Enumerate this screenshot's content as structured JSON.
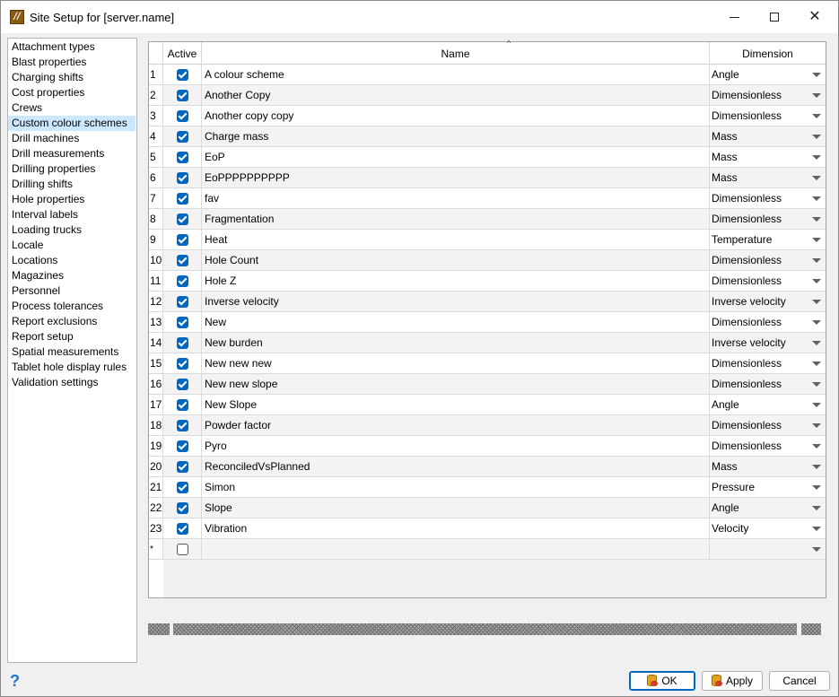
{
  "window": {
    "title": "Site Setup for [server.name]",
    "app_icon": "app-logo-icon",
    "controls": [
      "minimize-icon",
      "maximize-icon",
      "close-icon"
    ]
  },
  "sidebar": {
    "selected": "Custom colour schemes",
    "items": [
      "Attachment types",
      "Blast properties",
      "Charging shifts",
      "Cost properties",
      "Crews",
      "Custom colour schemes",
      "Drill machines",
      "Drill measurements",
      "Drilling properties",
      "Drilling shifts",
      "Hole properties",
      "Interval labels",
      "Loading trucks",
      "Locale",
      "Locations",
      "Magazines",
      "Personnel",
      "Process tolerances",
      "Report exclusions",
      "Report setup",
      "Spatial measurements",
      "Tablet hole display rules",
      "Validation settings"
    ]
  },
  "grid": {
    "columns": {
      "active": "Active",
      "name": "Name",
      "dimension": "Dimension"
    },
    "sorted_column": "Name",
    "rows": [
      {
        "num": "1",
        "active": true,
        "name": "A colour scheme",
        "dimension": "Angle"
      },
      {
        "num": "2",
        "active": true,
        "name": "Another Copy",
        "dimension": "Dimensionless"
      },
      {
        "num": "3",
        "active": true,
        "name": "Another copy copy",
        "dimension": "Dimensionless"
      },
      {
        "num": "4",
        "active": true,
        "name": "Charge mass",
        "dimension": "Mass"
      },
      {
        "num": "5",
        "active": true,
        "name": "EoP",
        "dimension": "Mass"
      },
      {
        "num": "6",
        "active": true,
        "name": "EoPPPPPPPPPP",
        "dimension": "Mass"
      },
      {
        "num": "7",
        "active": true,
        "name": "fav",
        "dimension": "Dimensionless"
      },
      {
        "num": "8",
        "active": true,
        "name": "Fragmentation",
        "dimension": "Dimensionless"
      },
      {
        "num": "9",
        "active": true,
        "name": "Heat",
        "dimension": "Temperature"
      },
      {
        "num": "10",
        "active": true,
        "name": "Hole Count",
        "dimension": "Dimensionless"
      },
      {
        "num": "11",
        "active": true,
        "name": "Hole Z",
        "dimension": "Dimensionless"
      },
      {
        "num": "12",
        "active": true,
        "name": "Inverse velocity",
        "dimension": "Inverse velocity"
      },
      {
        "num": "13",
        "active": true,
        "name": "New",
        "dimension": "Dimensionless"
      },
      {
        "num": "14",
        "active": true,
        "name": "New burden",
        "dimension": "Inverse velocity"
      },
      {
        "num": "15",
        "active": true,
        "name": "New new new",
        "dimension": "Dimensionless"
      },
      {
        "num": "16",
        "active": true,
        "name": "New new slope",
        "dimension": "Dimensionless"
      },
      {
        "num": "17",
        "active": true,
        "name": "New Slope",
        "dimension": "Angle"
      },
      {
        "num": "18",
        "active": true,
        "name": "Powder factor",
        "dimension": "Dimensionless"
      },
      {
        "num": "19",
        "active": true,
        "name": "Pyro",
        "dimension": "Dimensionless"
      },
      {
        "num": "20",
        "active": true,
        "name": "ReconciledVsPlanned",
        "dimension": "Mass"
      },
      {
        "num": "21",
        "active": true,
        "name": "Simon",
        "dimension": "Pressure"
      },
      {
        "num": "22",
        "active": true,
        "name": "Slope",
        "dimension": "Angle"
      },
      {
        "num": "23",
        "active": true,
        "name": "Vibration",
        "dimension": "Velocity"
      },
      {
        "num": "*",
        "active": false,
        "name": "",
        "dimension": ""
      }
    ]
  },
  "footer": {
    "help_icon": "help-icon",
    "ok_label": "OK",
    "apply_label": "Apply",
    "cancel_label": "Cancel"
  }
}
